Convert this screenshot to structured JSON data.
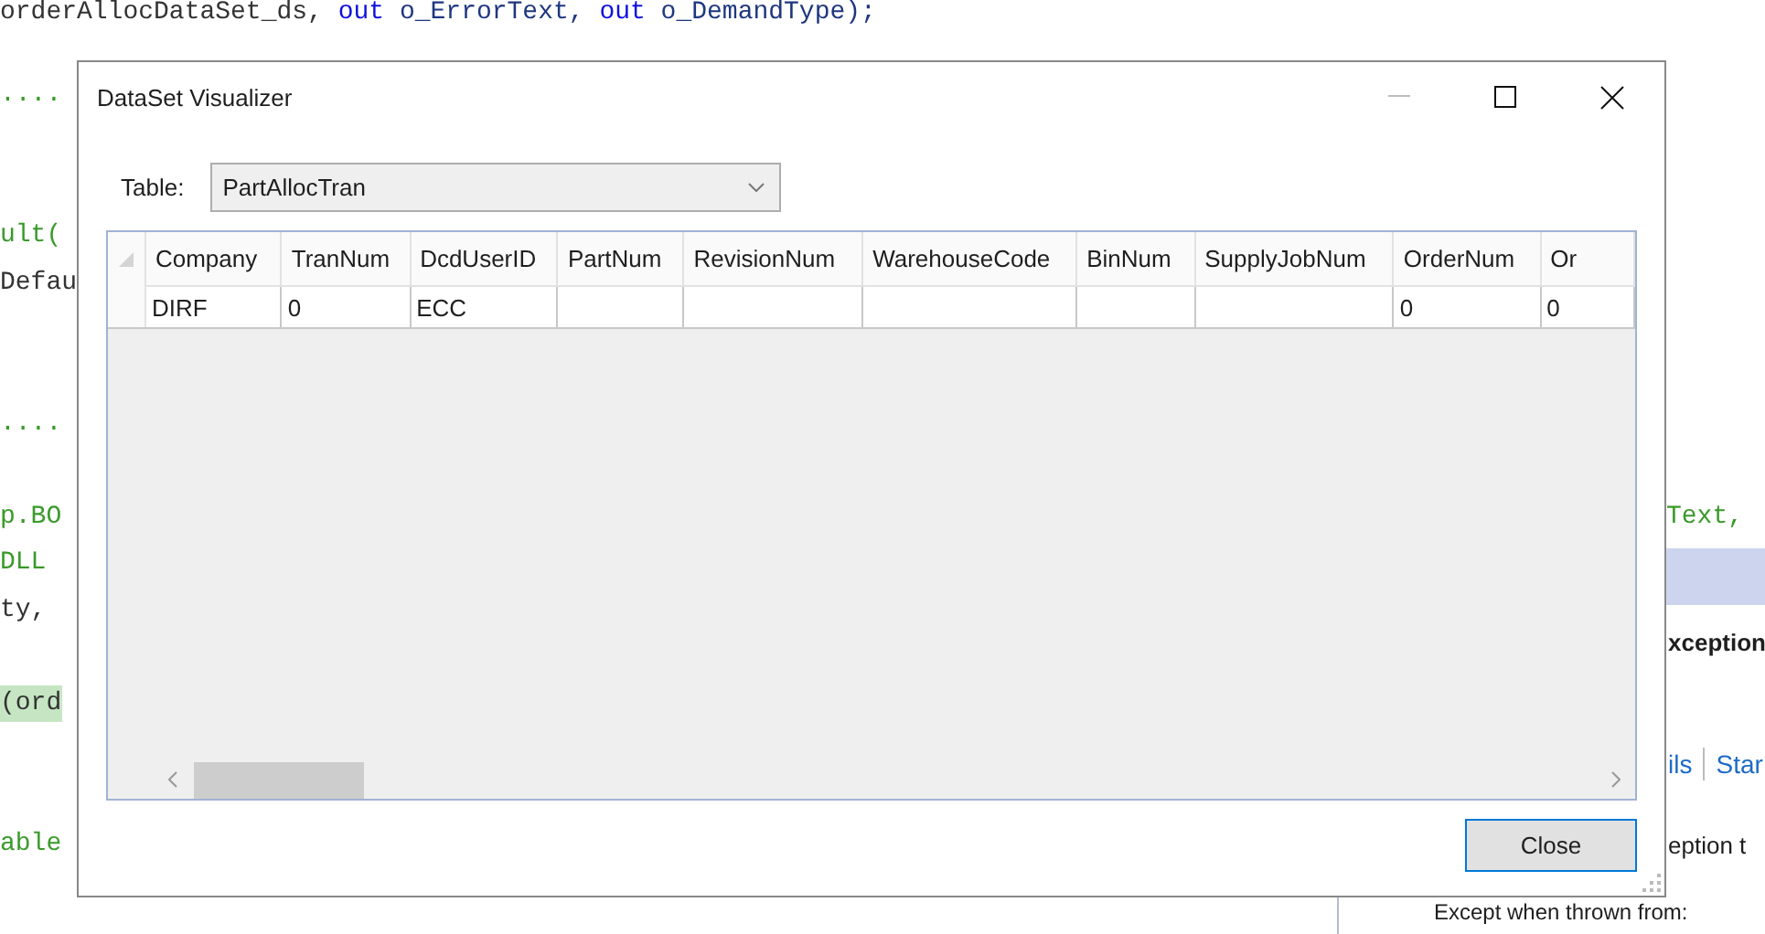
{
  "editor": {
    "lines": [
      {
        "kind": "code",
        "highlight": false,
        "segments": [
          {
            "text": "orderAllocDataSet_ds, ",
            "kind": "ident"
          },
          {
            "text": "out",
            "kind": "keyword"
          },
          {
            "text": " o_ErrorText, ",
            "kind": "param"
          },
          {
            "text": "out",
            "kind": "keyword"
          },
          {
            "text": " o_DemandType);",
            "kind": "param"
          }
        ]
      },
      {
        "kind": "blank"
      },
      {
        "kind": "code",
        "highlight": false,
        "segments": [
          {
            "text": "....",
            "kind": "comment"
          }
        ]
      },
      {
        "kind": "blank"
      },
      {
        "kind": "blank"
      },
      {
        "kind": "code",
        "highlight": false,
        "segments": [
          {
            "text": "ult(",
            "kind": "type"
          }
        ]
      },
      {
        "kind": "code",
        "highlight": false,
        "segments": [
          {
            "text": "Defau",
            "kind": "ident"
          }
        ]
      },
      {
        "kind": "blank"
      },
      {
        "kind": "blank"
      },
      {
        "kind": "code",
        "highlight": false,
        "segments": [
          {
            "text": "....",
            "kind": "comment"
          }
        ]
      },
      {
        "kind": "blank"
      },
      {
        "kind": "code",
        "highlight": false,
        "segments": [
          {
            "text": "p.BO",
            "kind": "type"
          }
        ],
        "tail": "Text,"
      },
      {
        "kind": "code",
        "highlight": false,
        "segments": [
          {
            "text": "DLL",
            "kind": "type"
          }
        ]
      },
      {
        "kind": "code",
        "highlight": false,
        "segments": [
          {
            "text": "ty,",
            "kind": "ident"
          }
        ]
      },
      {
        "kind": "blank"
      },
      {
        "kind": "code",
        "highlight": true,
        "segments": [
          {
            "text": "(ord",
            "kind": "ident"
          }
        ]
      },
      {
        "kind": "blank"
      },
      {
        "kind": "blank"
      },
      {
        "kind": "code",
        "highlight": false,
        "segments": [
          {
            "text": "able",
            "kind": "type"
          }
        ]
      }
    ]
  },
  "exception_helper": {
    "title": "xception",
    "links": [
      "ils",
      "Star"
    ],
    "text": "eption t",
    "label": "Except when thrown from:"
  },
  "dialog": {
    "title": "DataSet Visualizer",
    "table_label": "Table:",
    "table_select": {
      "value": "PartAllocTran"
    },
    "grid": {
      "columns": [
        "Company",
        "TranNum",
        "DcdUserID",
        "PartNum",
        "RevisionNum",
        "WarehouseCode",
        "BinNum",
        "SupplyJobNum",
        "OrderNum",
        "Or"
      ],
      "rows": [
        {
          "cells": [
            "DIRF",
            "0",
            "ECC",
            null,
            null,
            null,
            null,
            null,
            "0",
            "0"
          ]
        }
      ]
    },
    "close_button": "Close"
  }
}
